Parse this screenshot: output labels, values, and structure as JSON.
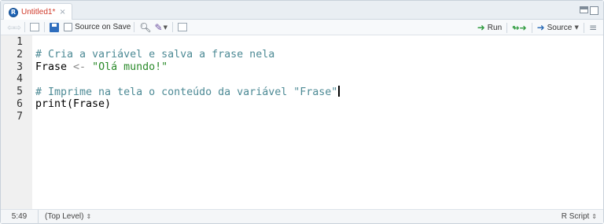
{
  "tab": {
    "title": "Untitled1*",
    "close_glyph": "×",
    "icon": "r-script-icon"
  },
  "toolbar": {
    "source_on_save_label": "Source on Save",
    "source_on_save_checked": false,
    "run_label": "Run",
    "source_label": "Source"
  },
  "editor": {
    "line_numbers": [
      "1",
      "2",
      "3",
      "4",
      "5",
      "6",
      "7"
    ],
    "lines": [
      {
        "segments": []
      },
      {
        "segments": [
          {
            "cls": "comment",
            "text": "# Cria a variável e salva a frase nela"
          }
        ]
      },
      {
        "segments": [
          {
            "cls": "",
            "text": "Frase "
          },
          {
            "cls": "op",
            "text": "<-"
          },
          {
            "cls": "",
            "text": " "
          },
          {
            "cls": "str",
            "text": "\"Olá mundo!\""
          }
        ]
      },
      {
        "segments": []
      },
      {
        "segments": [
          {
            "cls": "comment",
            "text": "# Imprime na tela o conteúdo da variável \"Frase\""
          }
        ],
        "cursor": true
      },
      {
        "segments": [
          {
            "cls": "",
            "text": "print(Frase)"
          }
        ]
      },
      {
        "segments": []
      }
    ]
  },
  "status": {
    "position": "5:49",
    "scope": "(Top Level)",
    "scope_arrows": "⇕",
    "file_type": "R Script",
    "file_type_arrows": "⇕"
  }
}
